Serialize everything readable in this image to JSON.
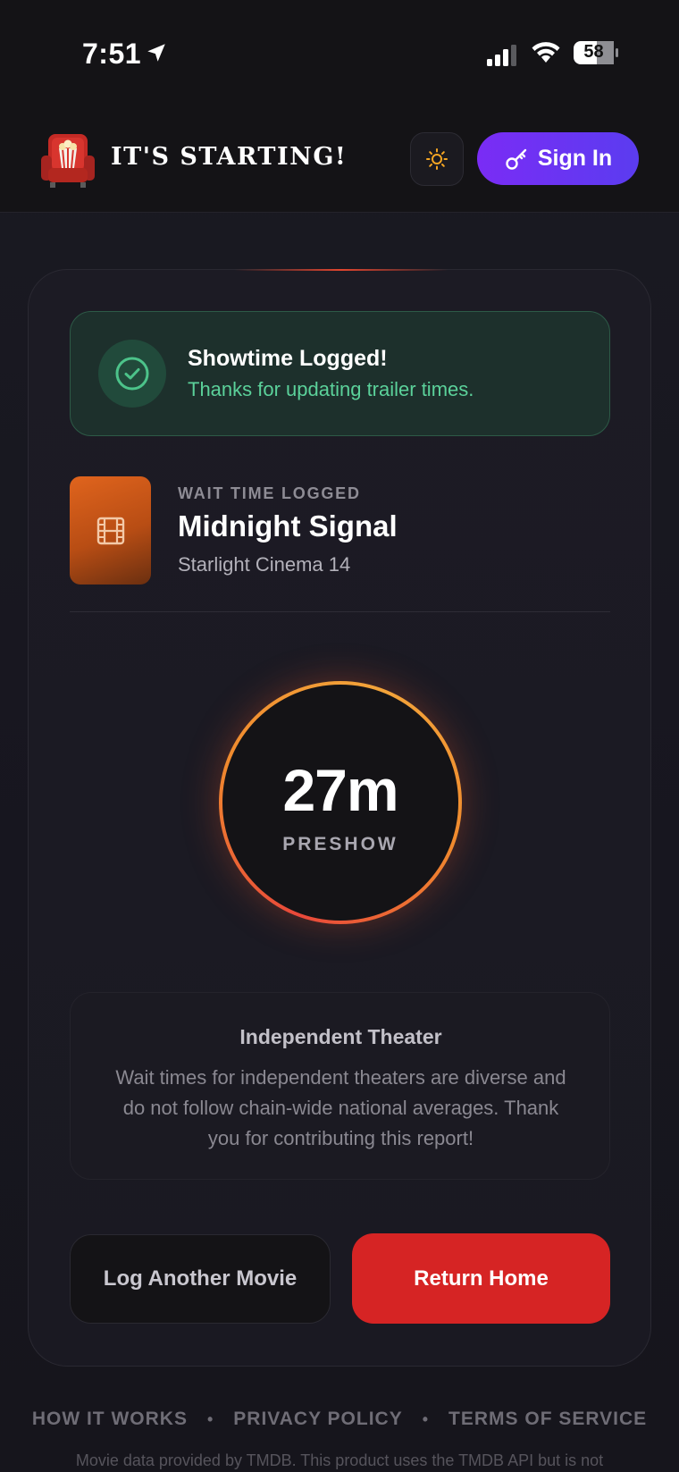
{
  "status_bar": {
    "time": "7:51",
    "battery": "58"
  },
  "header": {
    "brand": "IT'S STARTING!",
    "sign_in_label": "Sign In",
    "accent_color": "#6a34f3"
  },
  "success": {
    "title": "Showtime Logged!",
    "subtitle": "Thanks for updating trailer times."
  },
  "movie": {
    "kicker": "WAIT TIME LOGGED",
    "title": "Midnight Signal",
    "theater": "Starlight Cinema 14"
  },
  "wait": {
    "value": "27m",
    "label": "PRESHOW"
  },
  "note": {
    "title": "Independent Theater",
    "body": "Wait times for independent theaters are diverse and do not follow chain-wide national averages. Thank you for contributing this report!"
  },
  "actions": {
    "secondary_label": "Log Another Movie",
    "primary_label": "Return Home",
    "primary_color": "#d62424"
  },
  "footer": {
    "links": [
      "HOW IT WORKS",
      "PRIVACY POLICY",
      "TERMS OF SERVICE"
    ],
    "note": "Movie data provided by TMDB. This product uses the TMDB API but is not"
  },
  "icons": {
    "logo": "theater-seat-popcorn-icon",
    "theme": "sun-icon",
    "sign_in": "key-icon",
    "success": "check-circle-icon",
    "poster": "film-icon"
  }
}
